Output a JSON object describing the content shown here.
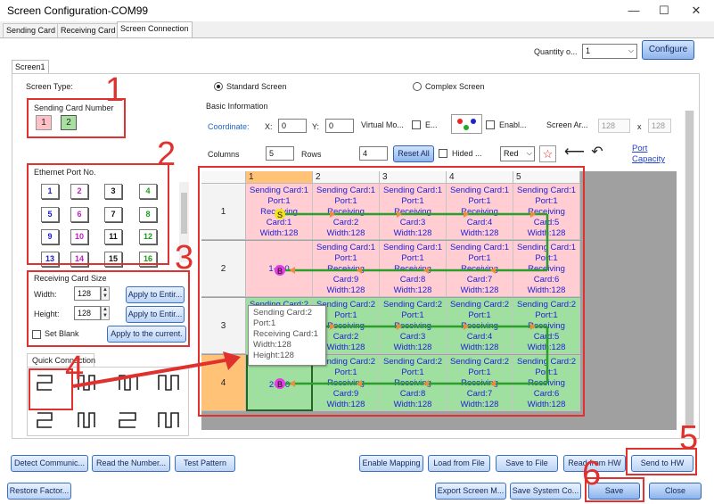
{
  "window": {
    "title": "Screen Configuration-COM99",
    "min": "—",
    "max": "☐",
    "close": "✕"
  },
  "tabs": [
    "Sending Card",
    "Receiving Card",
    "Screen Connection"
  ],
  "quantity": {
    "label": "Quantity o...",
    "value": "1",
    "configure": "Configure"
  },
  "screen_tab": "Screen1",
  "screen_type": {
    "label": "Screen Type:",
    "standard": "Standard Screen",
    "complex": "Complex Screen"
  },
  "sending_card": {
    "title": "Sending Card Number",
    "cards": [
      "1",
      "2"
    ]
  },
  "ethernet": {
    "title": "Ethernet Port No.",
    "ports": [
      "1",
      "2",
      "3",
      "4",
      "5",
      "6",
      "7",
      "8",
      "9",
      "10",
      "11",
      "12",
      "13",
      "14",
      "15",
      "16"
    ],
    "colors": [
      "#1a1ad0",
      "#c41ac4",
      "#111",
      "#1a9a1a",
      "#1a1ad0",
      "#c41ac4",
      "#111",
      "#1a9a1a",
      "#1a1ad0",
      "#c41ac4",
      "#111",
      "#1a9a1a",
      "#1a1ad0",
      "#c41ac4",
      "#111",
      "#1a9a1a"
    ]
  },
  "rcs": {
    "title": "Receiving Card Size",
    "width_label": "Width:",
    "width": "128",
    "height_label": "Height:",
    "height": "128",
    "apply_w": "Apply to Entir...",
    "apply_h": "Apply to Entir...",
    "blank": "Set Blank",
    "apply_cur": "Apply to the current."
  },
  "quick": {
    "title": "Quick Connection"
  },
  "basic": {
    "title": "Basic Information",
    "coordinate": "Coordinate:",
    "x": "X:",
    "xv": "0",
    "y": "Y:",
    "yv": "0",
    "vmode": "Virtual Mo...",
    "e": "E...",
    "enable": "Enabl...",
    "screen_area": "Screen Ar...",
    "aw": "128",
    "ax": "x",
    "ah": "128",
    "columns": "Columns",
    "cv": "5",
    "rows": "Rows",
    "rv": "4",
    "reset": "Reset All",
    "hided": "Hided ...",
    "color": "Red",
    "port_capacity": "Port Capacity",
    "star": "☆",
    "back": "⟵",
    "undo": "↶"
  },
  "grid": {
    "cols": [
      "1",
      "2",
      "3",
      "4",
      "5"
    ],
    "rows": [
      "1",
      "2",
      "3",
      "4"
    ],
    "cells": [
      [
        "Sending Card:1\nPort:1\nReceiving\nCard:1\nWidth:128",
        "Sending Card:1\nPort:1\nReceiving\nCard:2\nWidth:128",
        "Sending Card:1\nPort:1\nReceiving\nCard:3\nWidth:128",
        "Sending Card:1\nPort:1\nReceiving\nCard:4\nWidth:128",
        "Sending Card:1\nPort:1\nReceiving\nCard:5\nWidth:128"
      ],
      [
        "1-B-0",
        "Sending Card:1\nPort:1\nReceiving\nCard:9\nWidth:128",
        "Sending Card:1\nPort:1\nReceiving\nCard:8\nWidth:128",
        "Sending Card:1\nPort:1\nReceiving\nCard:7\nWidth:128",
        "Sending Card:1\nPort:1\nReceiving\nCard:6\nWidth:128"
      ],
      [
        "Sending Card:2\nPort:1",
        "Sending Card:2\nPort:1\nReceiving\nCard:2\nWidth:128",
        "Sending Card:2\nPort:1\nReceiving\nCard:3\nWidth:128",
        "Sending Card:2\nPort:1\nReceiving\nCard:4\nWidth:128",
        "Sending Card:2\nPort:1\nReceiving\nCard:5\nWidth:128"
      ],
      [
        "2-B-0",
        "Sending Card:2\nPort:1\nReceiving\nCard:9\nWidth:128",
        "Sending Card:2\nPort:1\nReceiving\nCard:8\nWidth:128",
        "Sending Card:2\nPort:1\nReceiving\nCard:7\nWidth:128",
        "Sending Card:2\nPort:1\nReceiving\nCard:6\nWidth:128"
      ]
    ]
  },
  "tooltip": [
    "Sending Card:2",
    "Port:1",
    "Receiving Card:1",
    "Width:128",
    "Height:128"
  ],
  "start_marker": "S",
  "end_marker": "B",
  "buttons": {
    "detect": "Detect Communic...",
    "read": "Read the Number...",
    "test": "Test Pattern",
    "enable_map": "Enable Mapping",
    "load": "Load from File",
    "save_file": "Save to File",
    "read_hw": "Read from HW",
    "send_hw": "Send to HW",
    "restore": "Restore Factor...",
    "export": "Export Screen M...",
    "save_sys": "Save System Co...",
    "save": "Save",
    "close": "Close"
  },
  "annotations": [
    "1",
    "2",
    "3",
    "4",
    "5",
    "6"
  ],
  "colors": {
    "accent": "#e0312e",
    "pink": "#ffcdd2",
    "green": "#9fdf9f",
    "selected": "#ffc277"
  }
}
